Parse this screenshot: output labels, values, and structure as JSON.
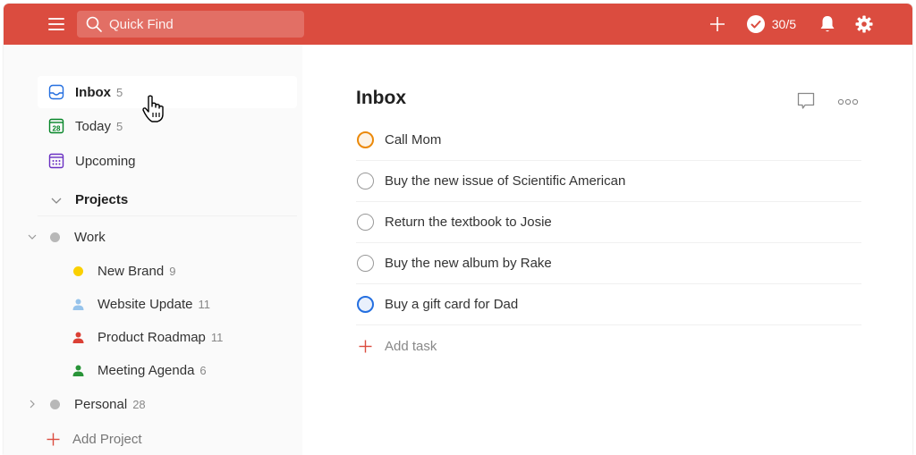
{
  "topbar": {
    "search_placeholder": "Quick Find",
    "karma": "30/5",
    "icons": [
      "menu-icon",
      "search-icon",
      "plus-icon",
      "check-circle-icon",
      "bell-icon",
      "gear-icon"
    ],
    "color": "#db4c3f"
  },
  "sidebar": {
    "nav": [
      {
        "label": "Inbox",
        "count": "5",
        "icon": "inbox-icon",
        "color": "#246fe0",
        "active": true
      },
      {
        "label": "Today",
        "count": "5",
        "icon": "calendar-today-icon",
        "day": "28",
        "color": "#058527"
      },
      {
        "label": "Upcoming",
        "count": "",
        "icon": "calendar-upcoming-icon",
        "color": "#692fc2"
      }
    ],
    "projects_label": "Projects",
    "projects": [
      {
        "label": "Work",
        "count": "",
        "color": "#b8b8b8",
        "expanded": true,
        "children": [
          {
            "label": "New Brand",
            "count": "9",
            "color": "#fad000",
            "type": "dot"
          },
          {
            "label": "Website Update",
            "count": "11",
            "color": "#96c3eb",
            "type": "person"
          },
          {
            "label": "Product Roadmap",
            "count": "11",
            "color": "#db4035",
            "type": "person"
          },
          {
            "label": "Meeting Agenda",
            "count": "6",
            "color": "#299438",
            "type": "person"
          }
        ]
      },
      {
        "label": "Personal",
        "count": "28",
        "color": "#b8b8b8",
        "expanded": false
      }
    ],
    "add_project": "Add Project"
  },
  "main": {
    "title": "Inbox",
    "tasks": [
      {
        "text": "Call Mom",
        "priority": "p2",
        "color": "#eb8909"
      },
      {
        "text": "Buy the new issue of Scientific American",
        "priority": "p4"
      },
      {
        "text": "Return the textbook to Josie",
        "priority": "p4"
      },
      {
        "text": "Buy the new album by Rake",
        "priority": "p4"
      },
      {
        "text": "Buy a gift card for Dad",
        "priority": "p3",
        "color": "#246fe0"
      }
    ],
    "add_task": "Add task"
  }
}
